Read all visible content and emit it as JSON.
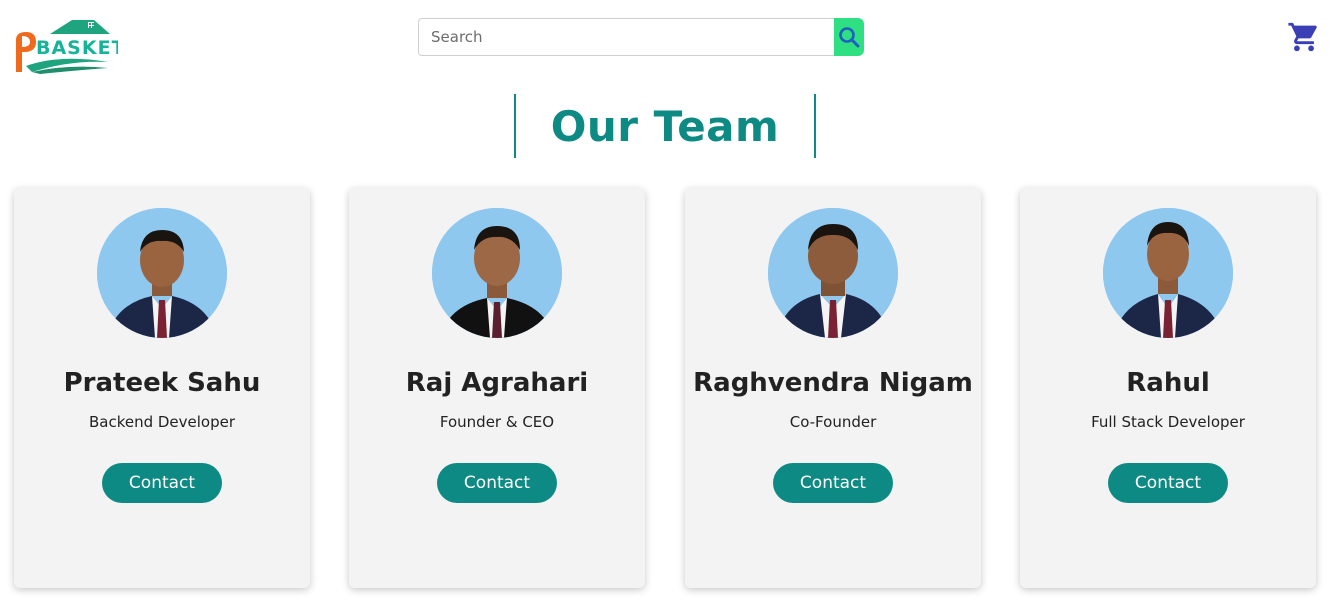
{
  "header": {
    "logo_text": "PBASKET",
    "search": {
      "placeholder": "Search",
      "value": ""
    },
    "search_icon": "search-icon",
    "cart_icon": "cart-icon"
  },
  "page_title": "Our Team",
  "team": [
    {
      "name": "Prateek Sahu",
      "role": "Backend Developer",
      "button": "Contact"
    },
    {
      "name": "Raj Agrahari",
      "role": "Founder & CEO",
      "button": "Contact"
    },
    {
      "name": "Raghvendra Nigam",
      "role": "Co-Founder",
      "button": "Contact"
    },
    {
      "name": "Rahul",
      "role": "Full Stack Developer",
      "button": "Contact"
    }
  ],
  "colors": {
    "accent": "#0e8a84",
    "search_button": "#2fe083",
    "cart": "#3a3fb5",
    "logo_orange": "#f06a1d",
    "logo_teal": "#1ea47f",
    "card_bg": "#f3f3f3"
  }
}
